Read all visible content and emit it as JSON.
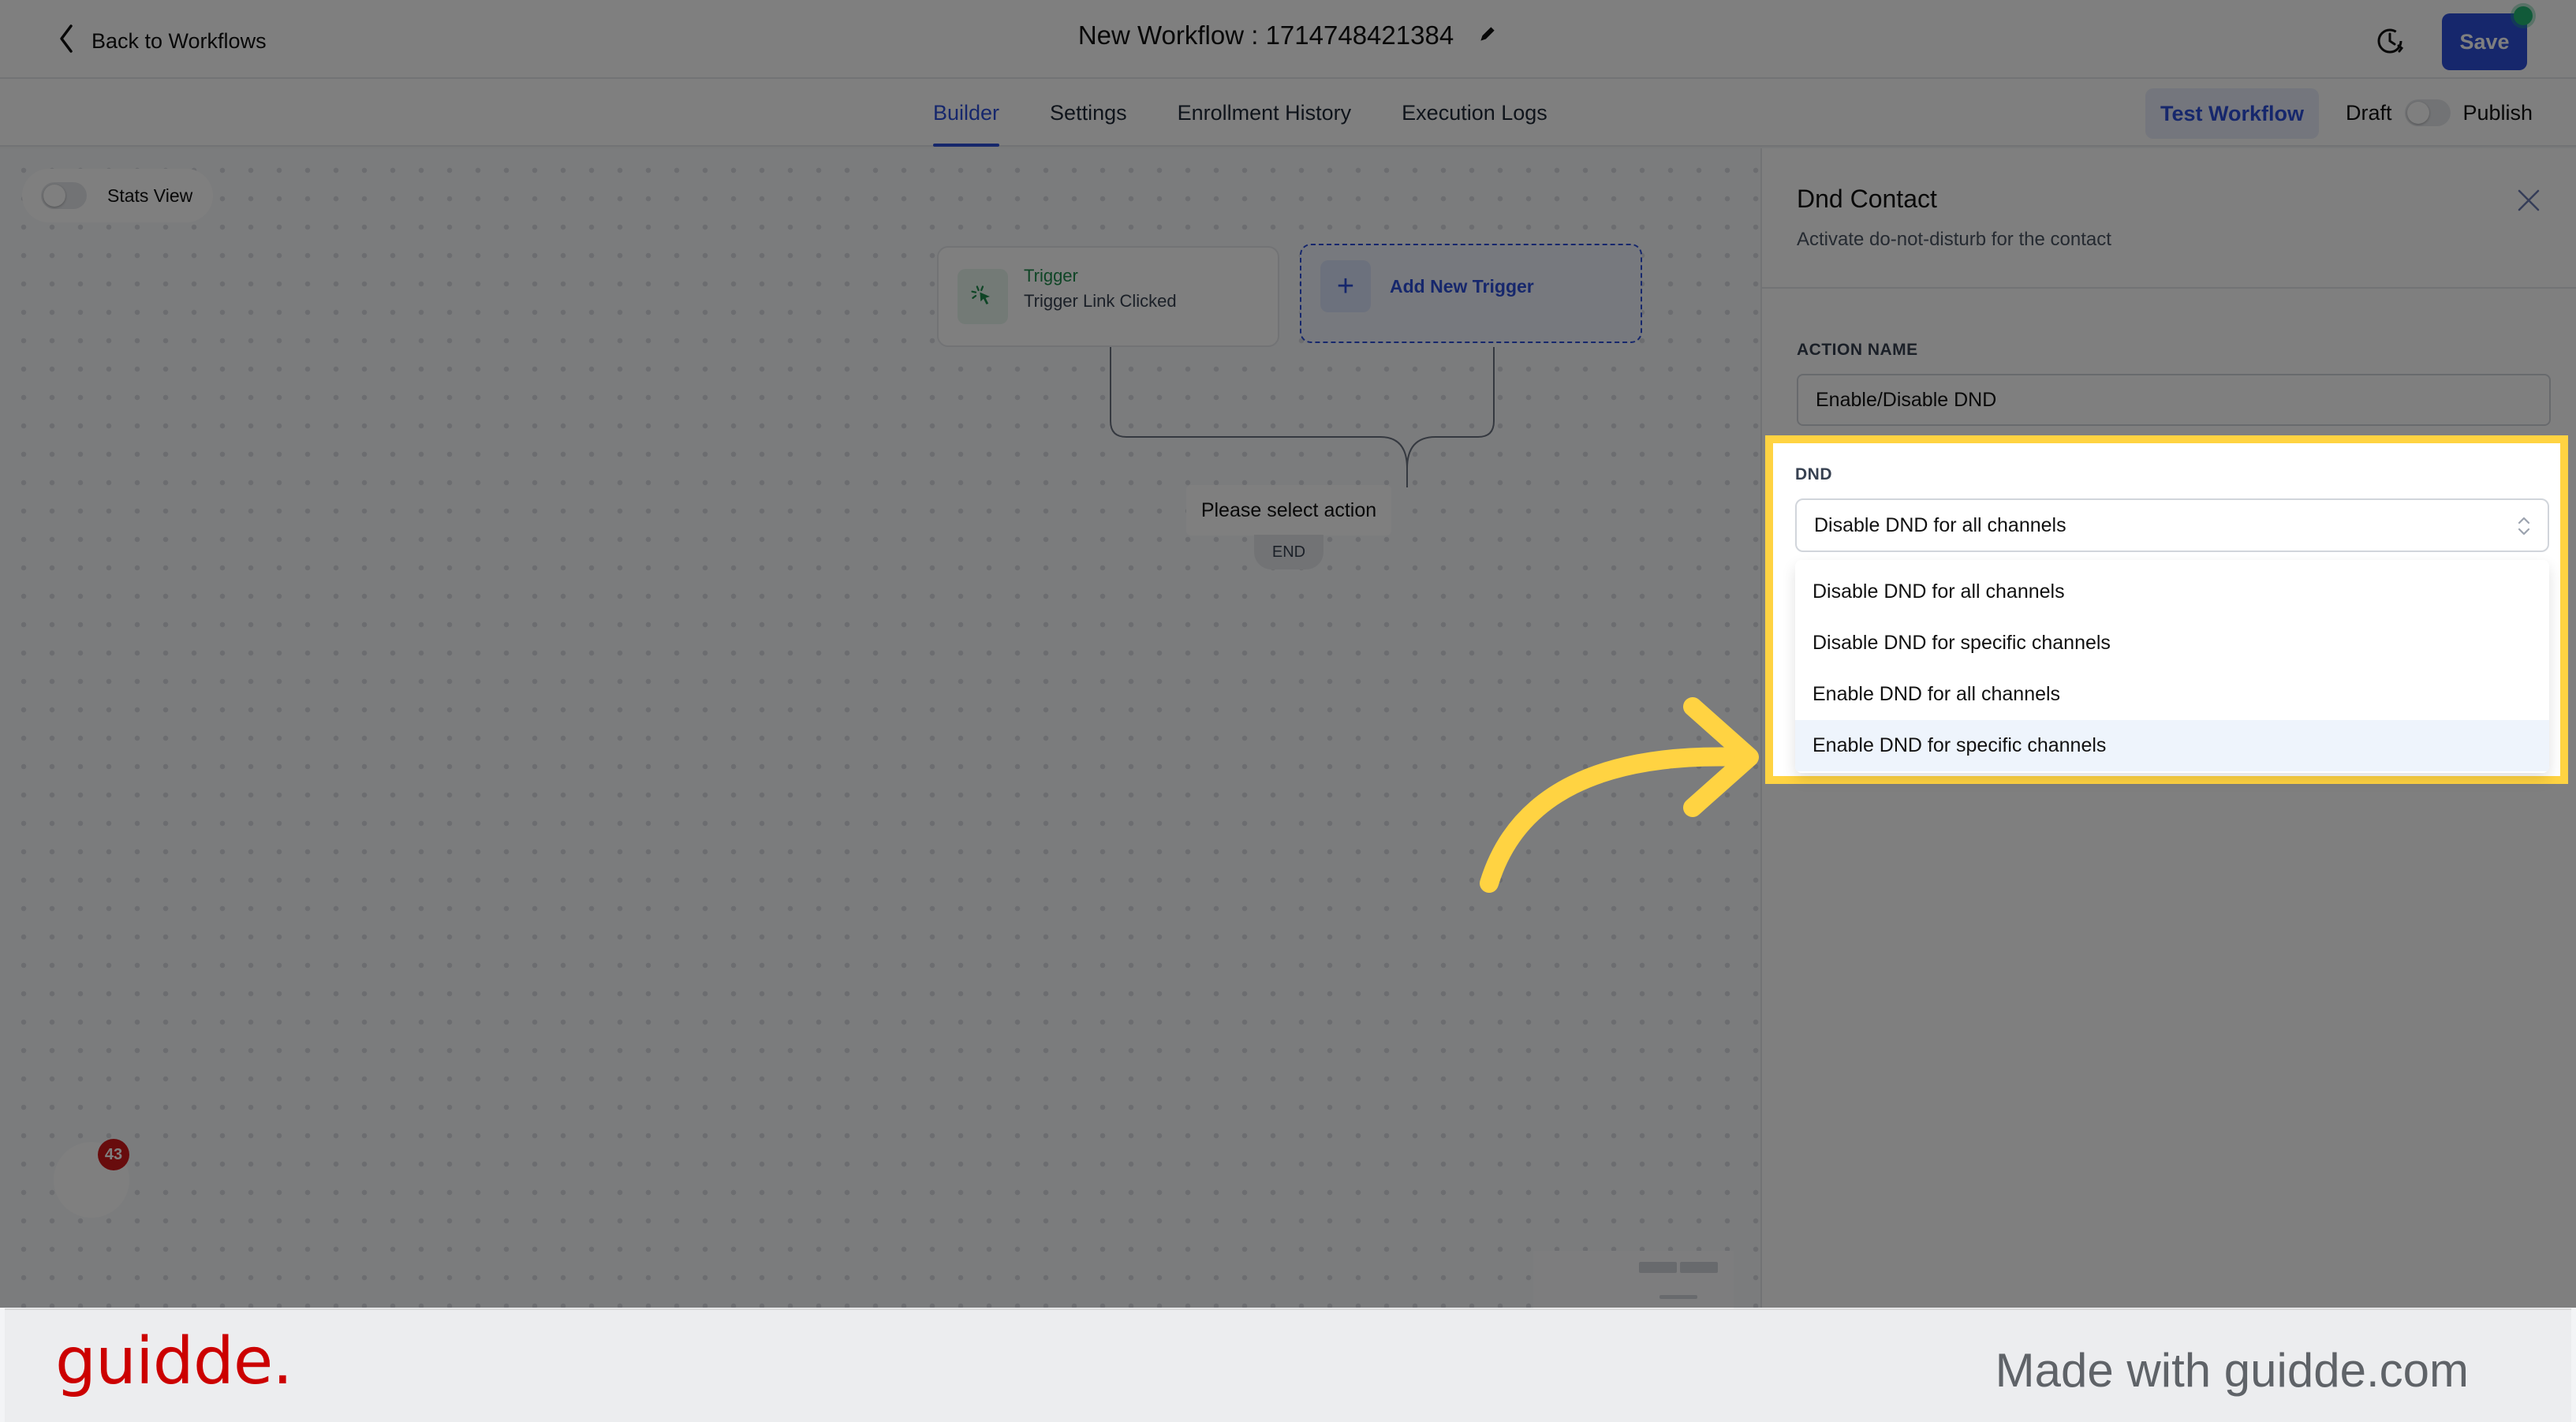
{
  "header": {
    "back_label": "Back to Workflows",
    "workflow_title": "New Workflow : 1714748421384",
    "save_label": "Save",
    "status_dot_color": "#22b573"
  },
  "tabs": [
    {
      "label": "Builder",
      "active": true
    },
    {
      "label": "Settings",
      "active": false
    },
    {
      "label": "Enrollment History",
      "active": false
    },
    {
      "label": "Execution Logs",
      "active": false
    }
  ],
  "toolbar": {
    "test_workflow_label": "Test Workflow",
    "draft_label": "Draft",
    "publish_label": "Publish",
    "published": false
  },
  "canvas": {
    "stats_view_label": "Stats View",
    "stats_view_on": false,
    "trigger": {
      "kind": "Trigger",
      "name": "Trigger Link Clicked"
    },
    "add_trigger_label": "Add New Trigger",
    "select_action_label": "Please select action",
    "end_label": "END",
    "chat_badge_count": "43"
  },
  "panel": {
    "title": "Dnd Contact",
    "subtitle": "Activate do-not-disturb for the contact",
    "action_name_label": "ACTION NAME",
    "action_name_value": "Enable/Disable DND",
    "dnd_label": "DND",
    "dnd_selected": "Disable DND for all channels",
    "dnd_options": [
      "Disable DND for all channels",
      "Disable DND for specific channels",
      "Enable DND for all channels",
      "Enable DND for specific channels"
    ],
    "dnd_hovered_index": 3
  },
  "colors": {
    "accent": "#2c4fd8",
    "highlight": "#ffd342",
    "trigger_green": "#1f8a4c",
    "brand_red": "#cc0000"
  },
  "footer": {
    "logo": "guidde.",
    "made_with": "Made with guidde.com"
  }
}
